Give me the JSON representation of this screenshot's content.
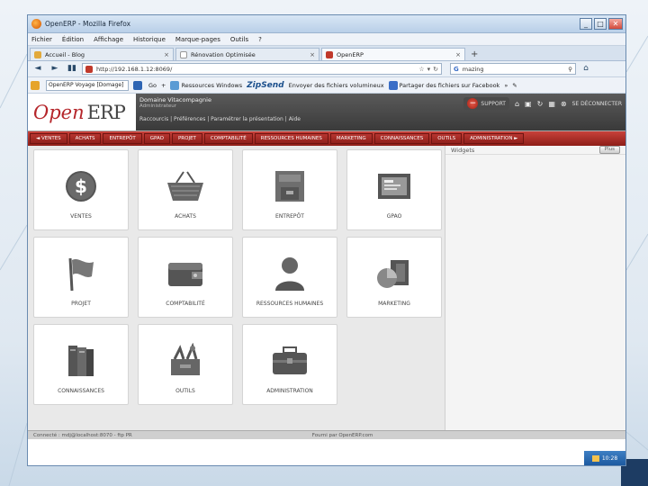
{
  "window": {
    "title": "OpenERP - Mozilla Firefox",
    "minimize": "_",
    "maximize": "□",
    "close": "✕"
  },
  "menubar": [
    "Fichier",
    "Édition",
    "Affichage",
    "Historique",
    "Marque-pages",
    "Outils",
    "?"
  ],
  "tabs": [
    {
      "label": "Accueil - Blog",
      "active": false
    },
    {
      "label": "Rénovation Optimisée",
      "active": false
    },
    {
      "label": "OpenERP",
      "active": true
    }
  ],
  "newtab": "+",
  "navbar": {
    "url": "http://192.168.1.12:8069/",
    "search_value": "mazing",
    "search_engine": "G"
  },
  "bookmarks": {
    "select_value": "OpenERP Voyage [Domage]",
    "go": "Go",
    "items": [
      "Ressources Windows",
      "Envoyer des fichiers volumineux",
      "Partager des fichiers sur Facebook"
    ],
    "zipsend": "ZipSend",
    "more": "»"
  },
  "erp": {
    "logo_open": "Open",
    "logo_erp": "ERP",
    "company": "Domaine Vitacompagnie",
    "subtitle": "Administrateur",
    "links": "Raccourcis | Préférences | Paramétrer la présentation | Aide",
    "support": "SUPPORT",
    "disconnect": "SE DÉCONNECTER"
  },
  "modules": [
    "◄ VENTES",
    "ACHATS",
    "ENTREPÔT",
    "GPAO",
    "PROJET",
    "COMPTABILITÉ",
    "RESSOURCES HUMAINES",
    "MARKETING",
    "CONNAISSANCES",
    "OUTILS",
    "ADMINISTRATION ►"
  ],
  "tiles": [
    {
      "label": "VENTES",
      "icon": "dollar-coin-icon"
    },
    {
      "label": "ACHATS",
      "icon": "shopping-basket-icon"
    },
    {
      "label": "ENTREPÔT",
      "icon": "warehouse-box-icon"
    },
    {
      "label": "GPAO",
      "icon": "gpao-monitor-icon"
    },
    {
      "label": "PROJET",
      "icon": "flag-icon"
    },
    {
      "label": "COMPTABILITÉ",
      "icon": "wallet-icon"
    },
    {
      "label": "RESSOURCES HUMAINES",
      "icon": "person-icon"
    },
    {
      "label": "MARKETING",
      "icon": "chart-cube-icon"
    },
    {
      "label": "CONNAISSANCES",
      "icon": "books-icon"
    },
    {
      "label": "OUTILS",
      "icon": "tools-box-icon"
    },
    {
      "label": "ADMINISTRATION",
      "icon": "briefcase-icon"
    }
  ],
  "widgets": {
    "title": "Widgets",
    "add": "Plus"
  },
  "footer": {
    "left": "Connecté : mdj@localhost:8070 - ftp PR",
    "center": "Fourni par OpenERP.com"
  },
  "tray": {
    "time": "10:28"
  },
  "colors": {
    "erp_red": "#b5252a",
    "module_bar": "#a32a24",
    "header_dark": "#444444"
  }
}
